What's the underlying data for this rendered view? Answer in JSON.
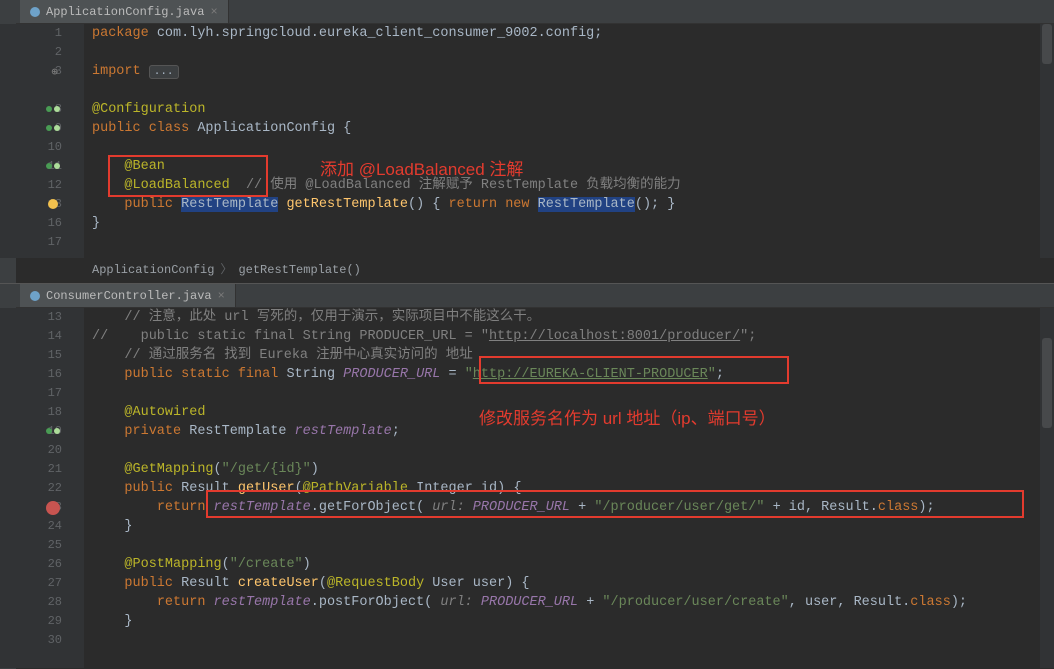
{
  "pane1": {
    "tab": {
      "label": "ApplicationConfig.java",
      "close": "×"
    },
    "lines": [
      "1",
      "2",
      "3",
      "8",
      "9",
      "10",
      "11",
      "12",
      "13",
      "16",
      "17"
    ],
    "crumbs": {
      "a": "ApplicationConfig",
      "b": "getRestTemplate()"
    },
    "code": {
      "l1_pkg": "package ",
      "l1_name": "com.lyh.springcloud.eureka_client_consumer_9002.config;",
      "l3_imp": "import ",
      "l8": "@Configuration",
      "l9_kw": "public class ",
      "l9_cls": "ApplicationConfig {",
      "l11": "@Bean",
      "l12_ann": "@LoadBalanced",
      "l12_ws": "  ",
      "l12_com": "// 使用 @LoadBalanced 注解赋予 RestTemplate 负载均衡的能力",
      "l13_kw1": "public ",
      "l13_rt": "RestTemplate",
      "l13_sp": " ",
      "l13_fn": "getRestTemplate",
      "l13_p": "() { ",
      "l13_ret": "return new ",
      "l13_rt2": "RestTemplate",
      "l13_end": "(); }",
      "l16": "}"
    },
    "annot": {
      "text": "添加 @LoadBalanced 注解"
    }
  },
  "pane2": {
    "tab": {
      "label": "ConsumerController.java",
      "close": "×"
    },
    "lines": [
      "13",
      "14",
      "15",
      "16",
      "17",
      "18",
      "19",
      "20",
      "21",
      "22",
      "23",
      "24",
      "25",
      "26",
      "27",
      "28",
      "29",
      "30"
    ],
    "code": {
      "l13": "// 注意，此处 url 写死的，仅用于演示，实际项目中不能这么干。",
      "l14_a": "//    public static final String PRODUCER_URL = \"",
      "l14_u": "http://localhost:8001/producer/",
      "l14_b": "\";",
      "l15": "// 通过服务名 找到 Eureka 注册中心真实访问的 地址",
      "l16_kw": "public static final ",
      "l16_ty": "String ",
      "l16_nm": "PRODUCER_URL",
      "l16_eq": " = ",
      "l16_q": "\"",
      "l16_u": "http://EUREKA-CLIENT-PRODUCER",
      "l16_q2": "\"",
      "l16_sc": ";",
      "l18": "@Autowired",
      "l19_kw": "private ",
      "l19_ty": "RestTemplate ",
      "l19_nm": "restTemplate",
      "l19_sc": ";",
      "l21_ann": "@GetMapping",
      "l21_p": "(",
      "l21_s": "\"/get/{id}\"",
      "l21_cp": ")",
      "l22_kw": "public ",
      "l22_ty": "Result ",
      "l22_fn": "getUser",
      "l22_p": "(",
      "l22_pv": "@PathVariable",
      "l22_sp": " ",
      "l22_it": "Integer id) {",
      "l23_ret": "return ",
      "l23_rt": "restTemplate",
      "l23_dot": ".getForObject( ",
      "l23_par": "url: ",
      "l23_pu": "PRODUCER_URL",
      "l23_pl": " + ",
      "l23_s": "\"/producer/user/get/\"",
      "l23_pl2": " + id, Result.",
      "l23_cls": "class",
      "l23_end": ");",
      "l24": "}",
      "l26_ann": "@PostMapping",
      "l26_p": "(",
      "l26_s": "\"/create\"",
      "l26_cp": ")",
      "l27_kw": "public ",
      "l27_ty": "Result ",
      "l27_fn": "createUser",
      "l27_p": "(",
      "l27_rb": "@RequestBody",
      "l27_sp": " ",
      "l27_rest": "User user) {",
      "l28_ret": "return ",
      "l28_rt": "restTemplate",
      "l28_dot": ".postForObject( ",
      "l28_par": "url: ",
      "l28_pu": "PRODUCER_URL",
      "l28_pl": " + ",
      "l28_s": "\"/producer/user/create\"",
      "l28_rest": ", user, Result.",
      "l28_cls": "class",
      "l28_end": ");",
      "l29": "}"
    },
    "annot": {
      "text": "修改服务名作为 url 地址（ip、端口号）"
    }
  }
}
